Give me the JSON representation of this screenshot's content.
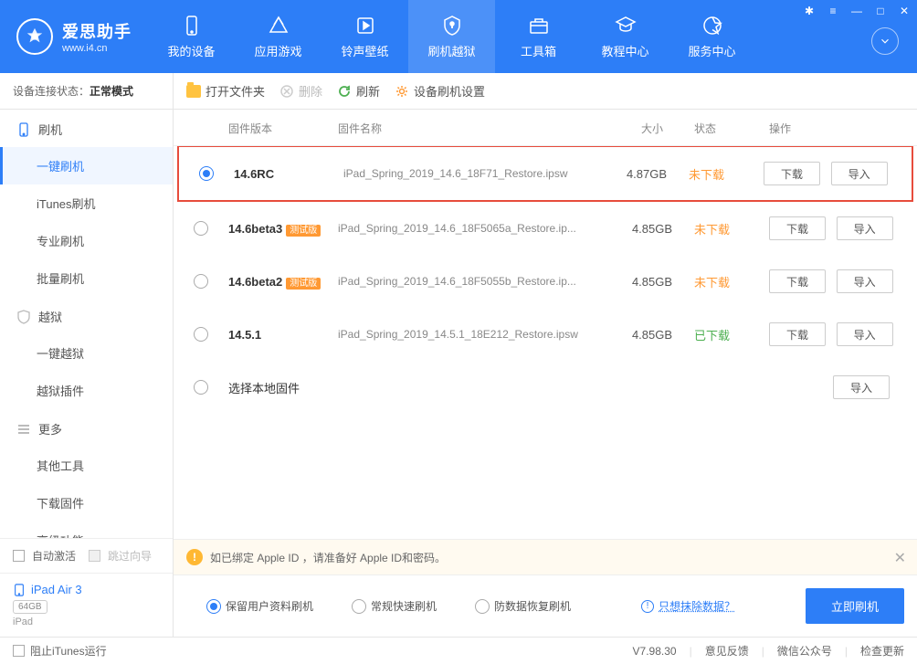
{
  "app": {
    "title": "爱思助手",
    "url": "www.i4.cn"
  },
  "nav": [
    {
      "label": "我的设备"
    },
    {
      "label": "应用游戏"
    },
    {
      "label": "铃声壁纸"
    },
    {
      "label": "刷机越狱"
    },
    {
      "label": "工具箱"
    },
    {
      "label": "教程中心"
    },
    {
      "label": "服务中心"
    }
  ],
  "device_status": {
    "label": "设备连接状态：",
    "value": "正常模式"
  },
  "toolbar": {
    "open_folder": "打开文件夹",
    "delete": "删除",
    "refresh": "刷新",
    "settings": "设备刷机设置"
  },
  "sidebar": {
    "groups": [
      {
        "label": "刷机",
        "items": [
          "一键刷机",
          "iTunes刷机",
          "专业刷机",
          "批量刷机"
        ]
      },
      {
        "label": "越狱",
        "items": [
          "一键越狱",
          "越狱插件"
        ]
      },
      {
        "label": "更多",
        "items": [
          "其他工具",
          "下载固件",
          "高级功能"
        ]
      }
    ],
    "auto_activate": "自动激活",
    "skip_wizard": "跳过向导",
    "device": {
      "name": "iPad Air 3",
      "storage": "64GB",
      "type": "iPad"
    }
  },
  "table": {
    "headers": {
      "version": "固件版本",
      "name": "固件名称",
      "size": "大小",
      "status": "状态",
      "action": "操作"
    },
    "rows": [
      {
        "version": "14.6RC",
        "badge": "",
        "name": "iPad_Spring_2019_14.6_18F71_Restore.ipsw",
        "size": "4.87GB",
        "status": "未下载",
        "status_class": "status-orange",
        "selected": true
      },
      {
        "version": "14.6beta3",
        "badge": "测试版",
        "name": "iPad_Spring_2019_14.6_18F5065a_Restore.ip...",
        "size": "4.85GB",
        "status": "未下载",
        "status_class": "status-orange",
        "selected": false
      },
      {
        "version": "14.6beta2",
        "badge": "测试版",
        "name": "iPad_Spring_2019_14.6_18F5055b_Restore.ip...",
        "size": "4.85GB",
        "status": "未下载",
        "status_class": "status-orange",
        "selected": false
      },
      {
        "version": "14.5.1",
        "badge": "",
        "name": "iPad_Spring_2019_14.5.1_18E212_Restore.ipsw",
        "size": "4.85GB",
        "status": "已下载",
        "status_class": "status-green",
        "selected": false
      }
    ],
    "local_firmware": "选择本地固件",
    "download_btn": "下载",
    "import_btn": "导入"
  },
  "notice": "如已绑定 Apple ID ，请准备好 Apple ID和密码。",
  "options": {
    "opt1": "保留用户资料刷机",
    "opt2": "常规快速刷机",
    "opt3": "防数据恢复刷机",
    "erase_link": "只想抹除数据？",
    "flash_btn": "立即刷机"
  },
  "footer": {
    "prevent_itunes": "阻止iTunes运行",
    "version": "V7.98.30",
    "feedback": "意见反馈",
    "wechat": "微信公众号",
    "check_update": "检查更新"
  }
}
